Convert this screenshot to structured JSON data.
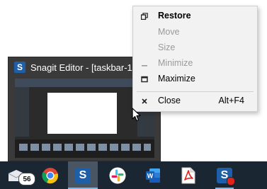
{
  "thumbnail": {
    "title": "Snagit Editor - [taskbar-1....",
    "app_icon_letter": "S"
  },
  "context_menu": {
    "items": [
      {
        "label": "Restore",
        "icon": "restore-icon",
        "enabled": true,
        "bold": true
      },
      {
        "label": "Move",
        "icon": "",
        "enabled": false
      },
      {
        "label": "Size",
        "icon": "",
        "enabled": false
      },
      {
        "label": "Minimize",
        "icon": "minimize-icon",
        "enabled": false
      },
      {
        "label": "Maximize",
        "icon": "maximize-icon",
        "enabled": true
      },
      {
        "label": "Close",
        "icon": "close-icon",
        "enabled": true,
        "shortcut": "Alt+F4"
      }
    ]
  },
  "taskbar": {
    "items": [
      {
        "name": "mail-icon",
        "badge": "56"
      },
      {
        "name": "chrome-icon"
      },
      {
        "name": "snagit-editor-icon",
        "active": true
      },
      {
        "name": "slack-icon"
      },
      {
        "name": "word-icon"
      },
      {
        "name": "acrobat-icon"
      },
      {
        "name": "snagit-capture-icon"
      }
    ]
  },
  "colors": {
    "taskbar_bg": "#1b2633",
    "accent": "#76b9ed",
    "menu_bg": "#f2f2f2"
  }
}
